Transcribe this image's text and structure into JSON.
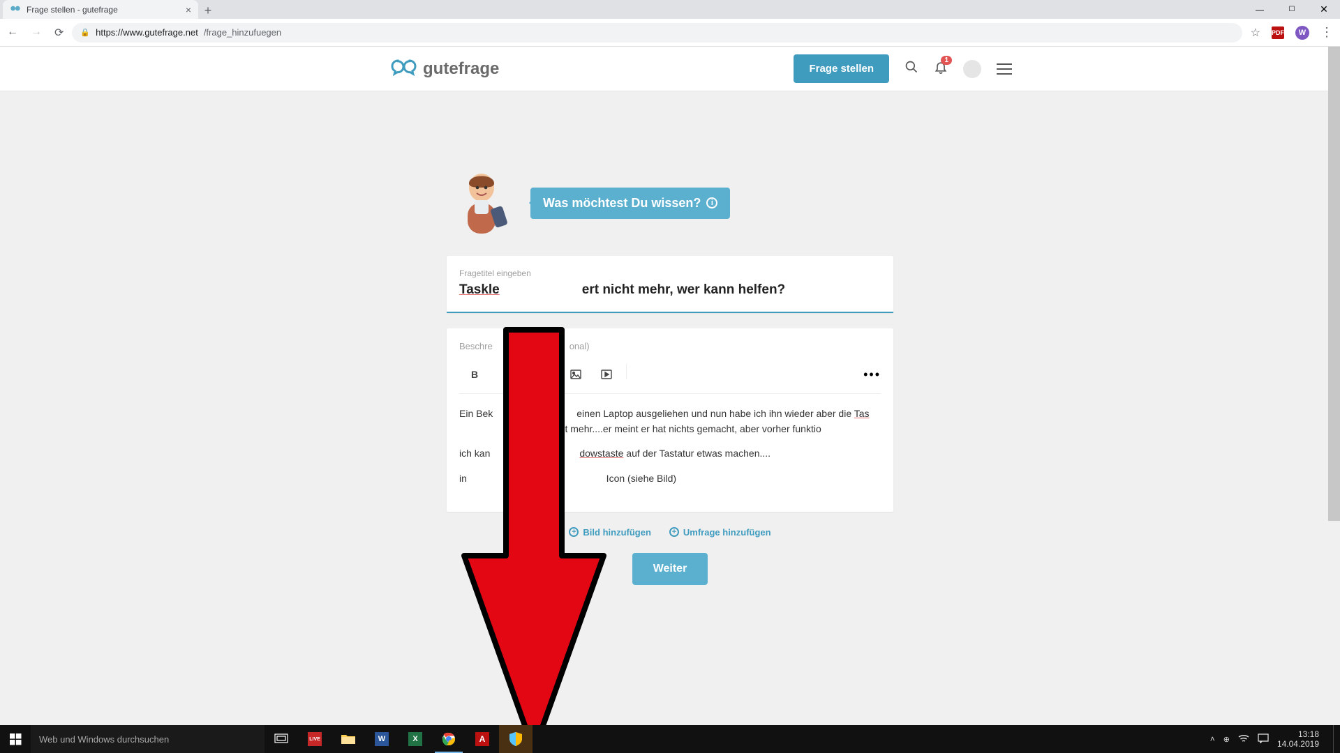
{
  "browser": {
    "tab_title": "Frage stellen - gutefrage",
    "url_host": "https://www.gutefrage.net",
    "url_path": "/frage_hinzufuegen",
    "profile_initial": "W"
  },
  "header": {
    "logo_text": "gutefrage",
    "ask_button": "Frage stellen",
    "notification_count": "1"
  },
  "hero": {
    "bubble_text": "Was möchtest Du wissen?"
  },
  "form": {
    "title_label": "Fragetitel eingeben",
    "title_part1": "Taskle",
    "title_part2": "ert nicht mehr, wer kann helfen?",
    "desc_label": "Beschre",
    "desc_label_suffix": "onal)",
    "body_p1a": "Ein Bek",
    "body_p1b": "einen Laptop ausgeliehen und nun habe ich ihn wieder aber die ",
    "body_p1c": "Tas",
    "body_p1d": "t nicht mehr....er meint er hat nichts gemacht, aber vorher funktio",
    "body_p2a": "ich kan",
    "body_p2b": "dowstaste",
    "body_p2c": " auf der Tastatur etwas machen....",
    "body_p3a": "in ",
    "body_p3b": " Icon (siehe Bild)",
    "add_image": "Bild hinzufügen",
    "add_poll": "Umfrage hinzufügen",
    "next_button": "Weiter"
  },
  "taskbar": {
    "search_placeholder": "Web und Windows durchsuchen",
    "time": "13:18",
    "date": "14.04.2019"
  }
}
